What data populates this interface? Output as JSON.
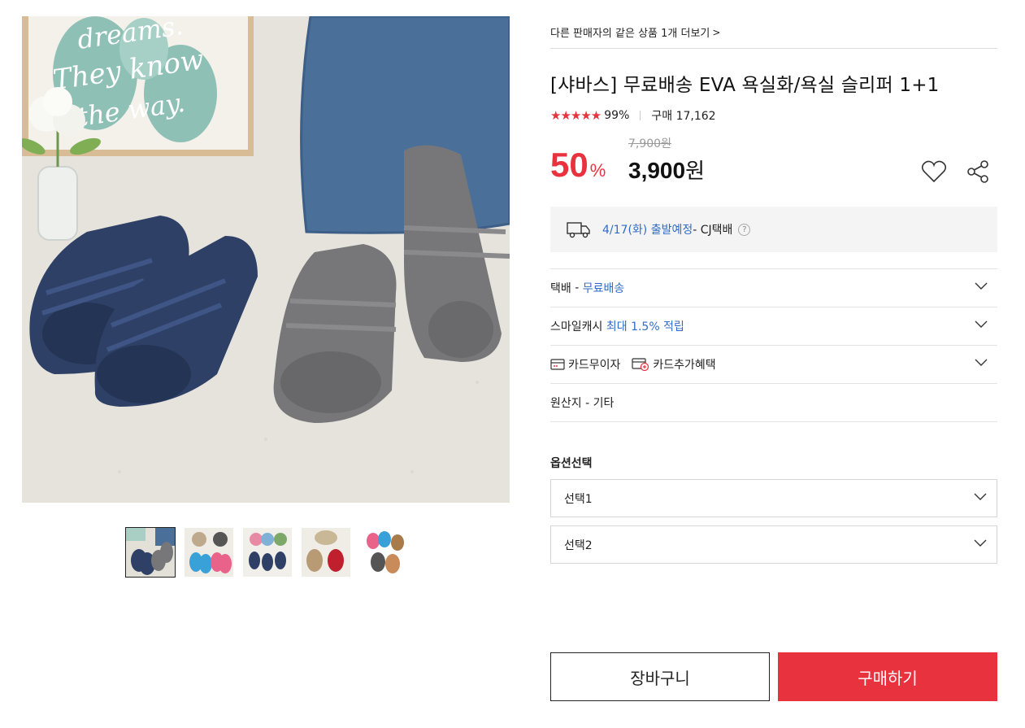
{
  "seller_link": {
    "label": "다른 판매자의 같은 상품 1개 더보기",
    "chevron": ">"
  },
  "product": {
    "title": "[샤바스] 무료배송 EVA 욕실화/욕실 슬리퍼 1+1",
    "stars": "★★★★★",
    "rating": "99%",
    "purchase": "구매 17,162"
  },
  "price": {
    "discount": "50",
    "percent_sign": "%",
    "original": "7,900원",
    "sale_amount": "3,900",
    "currency": "원"
  },
  "shipping": {
    "date": "4/17(화) 출발예정",
    "carrier": " - CJ택배",
    "help": "?"
  },
  "rows": {
    "delivery_label": "택배",
    "delivery_sep": " - ",
    "delivery_value": "무료배송",
    "smile_label": "스마일캐시 ",
    "smile_value": "최대 1.5% 적립",
    "card_interest": "카드무이자",
    "card_extra": "카드추가혜택",
    "origin": "원산지 - 기타"
  },
  "options": {
    "title": "옵션선택",
    "select1": "선택1",
    "select2": "선택2"
  },
  "buttons": {
    "cart": "장바구니",
    "buy": "구매하기"
  },
  "image_text": {
    "poster_line1": "dreams.",
    "poster_line2": "They know",
    "poster_line3": "the way."
  },
  "colors": {
    "accent_red": "#e8333f",
    "link_blue": "#2f6cc7",
    "navy_slipper": "#2e4066",
    "gray_slipper": "#77777a",
    "pillow_blue": "#4a6f99"
  },
  "thumbnails": [
    {
      "name": "thumb-navy-gray",
      "active": true
    },
    {
      "name": "thumb-blue-pink",
      "active": false
    },
    {
      "name": "thumb-pink-navy",
      "active": false
    },
    {
      "name": "thumb-beige-red",
      "active": false
    },
    {
      "name": "thumb-pattern",
      "active": false
    }
  ]
}
